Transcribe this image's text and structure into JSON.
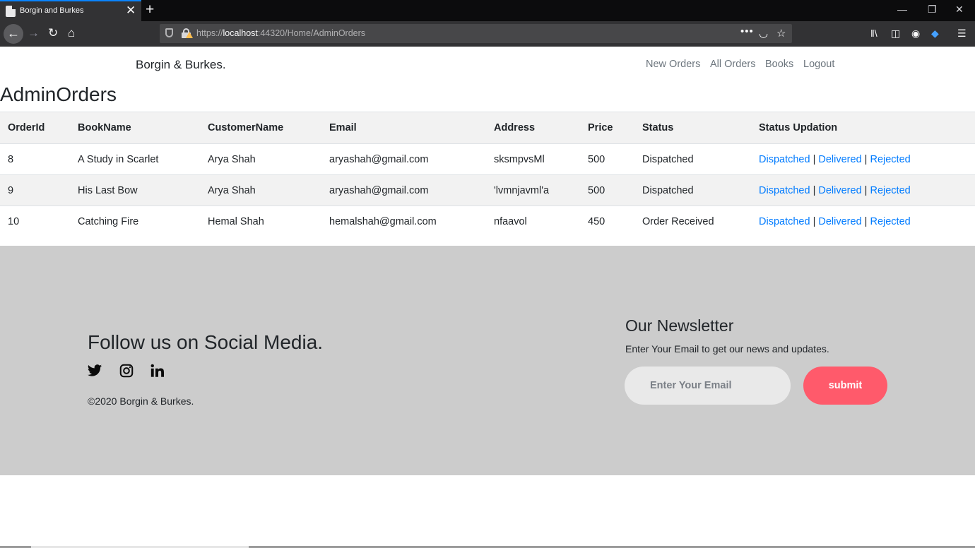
{
  "browser": {
    "tab_title": "Borgin and Burkes",
    "url_prefix": "https://",
    "url_host": "localhost",
    "url_rest": ":44320/Home/AdminOrders",
    "icons": [
      "back-icon",
      "forward-icon",
      "reload-icon",
      "home-icon",
      "shield-icon",
      "lock-warning-icon",
      "more-icon",
      "pocket-icon",
      "bookmark-star-icon",
      "library-icon",
      "sidebar-icon",
      "account-icon",
      "extension-icon",
      "menu-icon"
    ]
  },
  "site": {
    "brand": "Borgin & Burkes.",
    "nav": [
      "New Orders",
      "All Orders",
      "Books",
      "Logout"
    ]
  },
  "page": {
    "title": "AdminOrders"
  },
  "orders": {
    "headers": [
      "OrderId",
      "BookName",
      "CustomerName",
      "Email",
      "Address",
      "Price",
      "Status",
      "Status Updation"
    ],
    "rows": [
      [
        "8",
        "A Study in Scarlet",
        "Arya Shah",
        "aryashah@gmail.com",
        "sksmpvsMl",
        "500",
        "Dispatched"
      ],
      [
        "9",
        "His Last Bow",
        "Arya Shah",
        "aryashah@gmail.com",
        "'lvmnjavml'a",
        "500",
        "Dispatched"
      ],
      [
        "10",
        "Catching Fire",
        "Hemal Shah",
        "hemalshah@gmail.com",
        "nfaavol",
        "450",
        "Order Received"
      ]
    ],
    "actions": [
      "Dispatched",
      "Delivered",
      "Rejected"
    ],
    "separator": "|"
  },
  "footer": {
    "follow_title": "Follow us on Social Media.",
    "social_icons": [
      "twitter-icon",
      "instagram-icon",
      "linkedin-icon"
    ],
    "copyright": "©2020 Borgin & Burkes.",
    "newsletter_title": "Our Newsletter",
    "newsletter_subtitle": "Enter Your Email to get our news and updates.",
    "email_placeholder": "Enter Your Email",
    "submit_label": "submit"
  },
  "colors": {
    "link": "#007bff",
    "footer_bg": "#cccccc",
    "submit_bg": "#ff5a6b",
    "chrome_tab_accent": "#0a84ff"
  }
}
